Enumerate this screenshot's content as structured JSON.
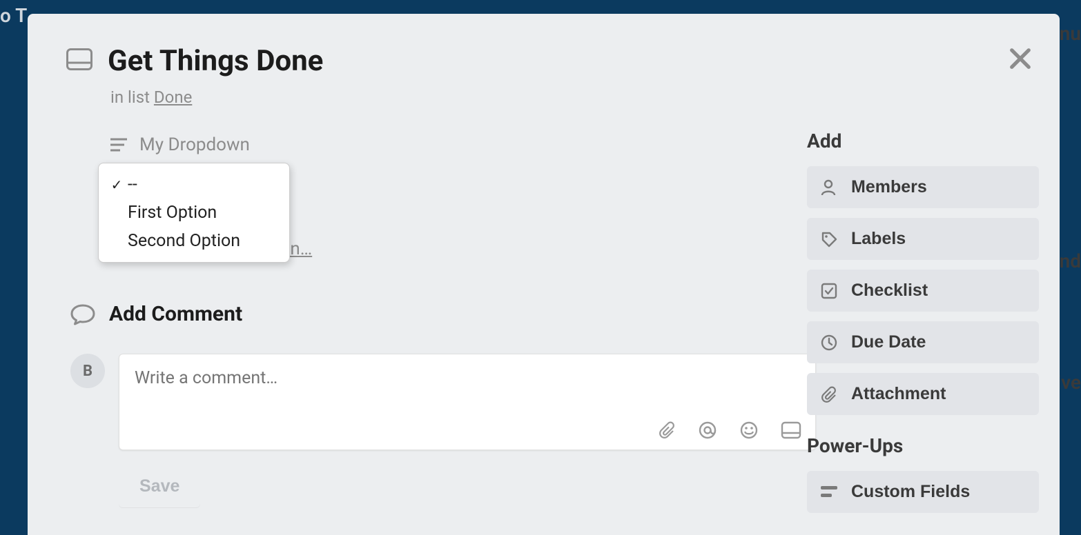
{
  "card": {
    "title": "Get Things Done",
    "list_prefix": "in list ",
    "list_name": "Done"
  },
  "custom_field": {
    "label": "My Dropdown",
    "options": [
      {
        "label": "--",
        "selected": true
      },
      {
        "label": "First Option",
        "selected": false
      },
      {
        "label": "Second Option",
        "selected": false
      }
    ]
  },
  "description": {
    "edit_text": "Edit the description…"
  },
  "comment": {
    "heading": "Add Comment",
    "avatar_initial": "B",
    "placeholder": "Write a comment…",
    "save_label": "Save"
  },
  "sidebar": {
    "add_heading": "Add",
    "buttons": {
      "members": "Members",
      "labels": "Labels",
      "checklist": "Checklist",
      "due_date": "Due Date",
      "attachment": "Attachment"
    },
    "powerups_heading": "Power-Ups",
    "custom_fields": "Custom Fields"
  },
  "background": {
    "frag1": "o T",
    "frag2": "nu",
    "frag3": "nd",
    "frag4": "ive"
  }
}
